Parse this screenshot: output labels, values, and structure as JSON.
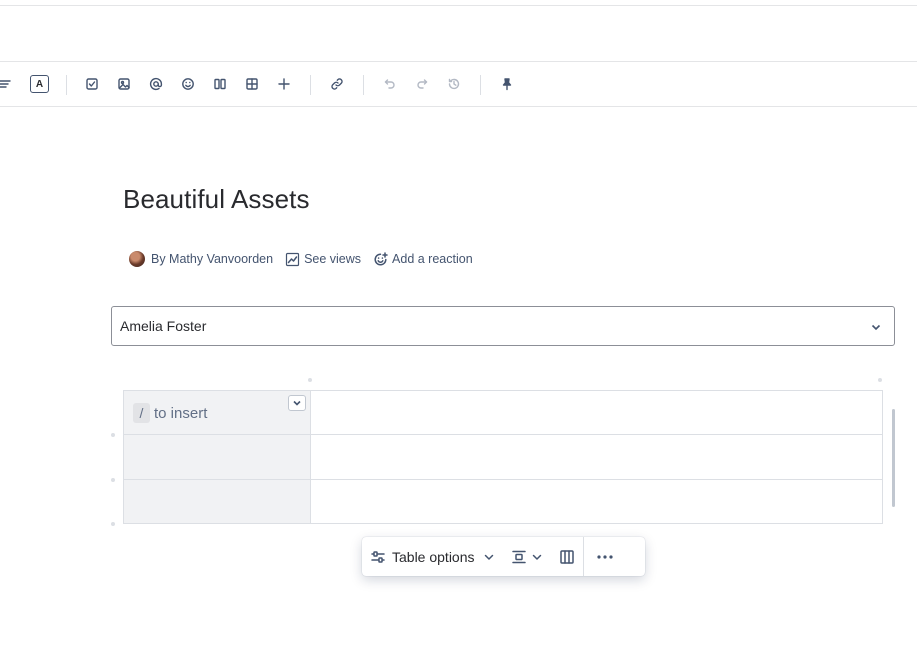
{
  "page": {
    "title": "Beautiful Assets"
  },
  "toolbar": {
    "text_color_label": "A",
    "icons": [
      "align-left-icon",
      "text-color-icon",
      "checkbox-icon",
      "image-icon",
      "mention-icon",
      "emoji-icon",
      "layout-icon",
      "table-icon",
      "plus-icon",
      "link-icon",
      "undo-icon",
      "redo-icon",
      "history-icon",
      "pin-icon"
    ]
  },
  "byline": {
    "author": "By Mathy Vanvoorden",
    "see_views": "See views",
    "add_reaction": "Add a reaction"
  },
  "dropdown": {
    "selected": "Amelia Foster"
  },
  "table": {
    "placeholder_key": "/",
    "placeholder_text": "to insert",
    "rows": 3,
    "columns": 2
  },
  "table_toolbar": {
    "options_label": "Table options"
  }
}
